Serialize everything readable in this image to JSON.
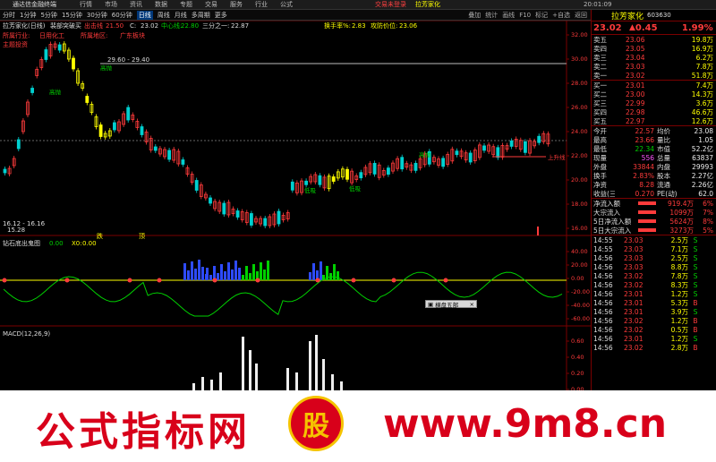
{
  "menubar": {
    "app_title": "通达信金融终端",
    "items": [
      "行情",
      "市场",
      "资讯",
      "数据",
      "专题",
      "交易",
      "服务",
      "行业",
      "公式"
    ],
    "trade_login": "交易未登录",
    "stock_name": "拉芳家化",
    "time": "20:01:09"
  },
  "toolbar": {
    "tabs": [
      "分时",
      "1分钟",
      "5分钟",
      "15分钟",
      "30分钟",
      "60分钟",
      "日线",
      "周线",
      "月线",
      "多周期",
      "更多"
    ],
    "active_tab": "日线",
    "tools": [
      "叠加",
      "统计",
      "画线",
      "F10",
      "标记",
      "+自选",
      "返回"
    ]
  },
  "main_chart": {
    "title": "拉芳家化(日线)",
    "indicator_name": "裴部突破买",
    "out_label": "出击线",
    "out_value": "21.50",
    "c_label": "C:",
    "c_value": "23.02",
    "mid_label": "中心线:",
    "mid_value": "22.80",
    "third_label": "三分之一:",
    "third_value": "22.87",
    "turnover_label": "换手率%:",
    "turnover_value": "2.83",
    "attack_label": "攻防价位:",
    "attack_value": "23.06",
    "industry_label": "所属行业:",
    "industry_value": "日用化工",
    "concept_label": "所属地区:",
    "concept_value": "广东板块",
    "bookmark": "主题投资",
    "range_label": "29.60 - 29.40",
    "low_label": "16.12 - 16.16",
    "low_label2": "15.28",
    "y_axis": [
      "32.00",
      "30.00",
      "28.00",
      "26.00",
      "24.00",
      "22.00",
      "20.00",
      "18.00",
      "16.00"
    ],
    "annotations": [
      "高抛",
      "高抛",
      "低吸",
      "低吸",
      "高抛"
    ],
    "breakout_label": "上升线"
  },
  "mid_chart": {
    "title": "钻石底出鬼图",
    "v1": "0.00",
    "v2_label": "X0:",
    "v2": "0.00",
    "y_axis": [
      "40.00",
      "20.00",
      "0.00",
      "-20.00",
      "-40.00",
      "-60.00"
    ],
    "marker_labels": [
      "跌",
      "顶"
    ]
  },
  "popup": {
    "label": "横盘五部"
  },
  "macd_chart": {
    "title": "MACD(12,26,9)",
    "y_axis": [
      "0.60",
      "0.40",
      "0.20",
      "0.00",
      "-0.20"
    ]
  },
  "quote": {
    "name": "拉芳家化",
    "code": "603630",
    "price": "23.02",
    "change": "0.45",
    "change_pct": "1.99%",
    "asks": [
      {
        "label": "卖五",
        "price": "23.06",
        "vol": "19.8万"
      },
      {
        "label": "卖四",
        "price": "23.05",
        "vol": "16.9万"
      },
      {
        "label": "卖三",
        "price": "23.04",
        "vol": "6.2万"
      },
      {
        "label": "卖二",
        "price": "23.03",
        "vol": "7.8万"
      },
      {
        "label": "卖一",
        "price": "23.02",
        "vol": "51.8万"
      }
    ],
    "bids": [
      {
        "label": "买一",
        "price": "23.01",
        "vol": "7.4万"
      },
      {
        "label": "买二",
        "price": "23.00",
        "vol": "14.3万"
      },
      {
        "label": "买三",
        "price": "22.99",
        "vol": "3.6万"
      },
      {
        "label": "买四",
        "price": "22.98",
        "vol": "46.6万"
      },
      {
        "label": "买五",
        "price": "22.97",
        "vol": "12.6万"
      }
    ],
    "stats": [
      {
        "l1": "今开",
        "v1": "22.57",
        "l2": "均价",
        "v2": "23.08"
      },
      {
        "l1": "最高",
        "v1": "23.66",
        "l2": "量比",
        "v2": "1.05"
      },
      {
        "l1": "最低",
        "v1": "22.34",
        "l2": "市值",
        "v2": "52.2亿"
      },
      {
        "l1": "现量",
        "v1": "556",
        "l2": "总量",
        "v2": "63837"
      },
      {
        "l1": "外盘",
        "v1": "33844",
        "l2": "内盘",
        "v2": "29993"
      },
      {
        "l1": "换手",
        "v1": "2.83%",
        "l2": "股本",
        "v2": "2.27亿"
      },
      {
        "l1": "净资",
        "v1": "8.28",
        "l2": "流通",
        "v2": "2.26亿"
      },
      {
        "l1": "收益(三)",
        "v1": "0.270",
        "l2": "PE(动)",
        "v2": "62.0"
      }
    ],
    "flows": [
      {
        "label": "净流入额",
        "value": "919.4万",
        "pct": "6%"
      },
      {
        "label": "大宗流入",
        "value": "1099万",
        "pct": "7%"
      },
      {
        "label": "5日净流入额",
        "value": "5624万",
        "pct": "8%"
      },
      {
        "label": "5日大宗流入",
        "value": "3273万",
        "pct": "5%"
      }
    ],
    "ticks": [
      {
        "t": "14:55",
        "p": "23.03",
        "v": "2.5万",
        "d": "S"
      },
      {
        "t": "14:55",
        "p": "23.03",
        "v": "7.1万",
        "d": "S"
      },
      {
        "t": "14:56",
        "p": "23.03",
        "v": "2.5万",
        "d": "S"
      },
      {
        "t": "14:56",
        "p": "23.03",
        "v": "8.8万",
        "d": "S"
      },
      {
        "t": "14:56",
        "p": "23.02",
        "v": "7.8万",
        "d": "S"
      },
      {
        "t": "14:56",
        "p": "23.02",
        "v": "8.3万",
        "d": "S"
      },
      {
        "t": "14:56",
        "p": "23.01",
        "v": "1.2万",
        "d": "S"
      },
      {
        "t": "14:56",
        "p": "23.01",
        "v": "5.3万",
        "d": "B"
      },
      {
        "t": "14:56",
        "p": "23.01",
        "v": "3.9万",
        "d": "S"
      },
      {
        "t": "14:56",
        "p": "23.02",
        "v": "1.2万",
        "d": "B"
      },
      {
        "t": "14:56",
        "p": "23.02",
        "v": "0.5万",
        "d": "B"
      },
      {
        "t": "14:56",
        "p": "23.01",
        "v": "1.2万",
        "d": "S"
      },
      {
        "t": "14:56",
        "p": "23.02",
        "v": "2.8万",
        "d": "B"
      }
    ]
  },
  "watermark": {
    "left_text": "公式指标网",
    "right_text": "www.9m8.cn",
    "logo_char": "股"
  },
  "colors": {
    "up": "#ff3b3b",
    "down": "#00d0d0",
    "yellow": "#ffff00",
    "green": "#00d000",
    "blue": "#2e4bff",
    "axis": "#7a0000",
    "watermark_red": "#d8001a",
    "watermark_yellow": "#f5c400"
  }
}
